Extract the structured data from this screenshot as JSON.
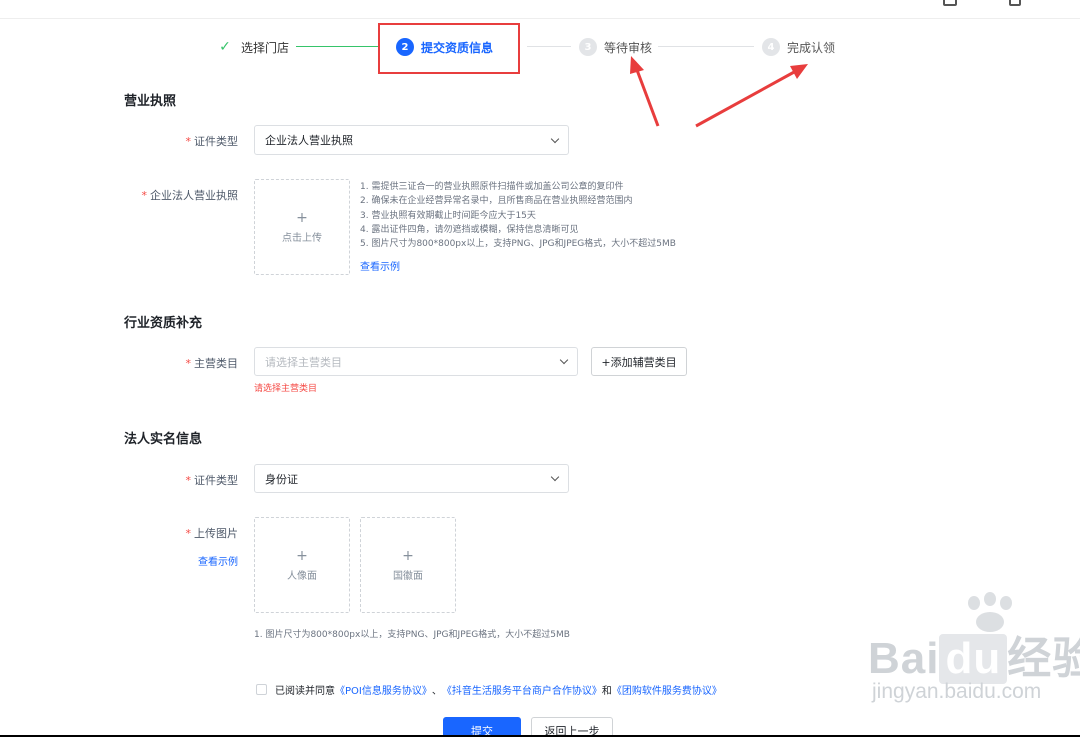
{
  "steps": [
    {
      "index": "✓",
      "label": "选择门店",
      "state": "done"
    },
    {
      "index": "2",
      "label": "提交资质信息",
      "state": "active"
    },
    {
      "index": "3",
      "label": "等待审核",
      "state": "wait"
    },
    {
      "index": "4",
      "label": "完成认领",
      "state": "wait"
    }
  ],
  "colors": {
    "primary": "#1966ff",
    "done": "#36c46a",
    "required": "#f54a45",
    "annotation": "#e83d3d"
  },
  "business_license": {
    "title": "营业执照",
    "cert_type_label": "证件类型",
    "cert_type_value": "企业法人营业执照",
    "license_label": "企业法人营业执照",
    "upload_text": "点击上传",
    "tips": [
      "1. 需提供三证合一的营业执照原件扫描件或加盖公司公章的复印件",
      "2. 确保未在企业经营异常名录中，且所售商品在营业执照经营范围内",
      "3. 营业执照有效期截止时间距今应大于15天",
      "4. 露出证件四角，请勿遮挡或模糊，保持信息清晰可见",
      "5. 图片尺寸为800*800px以上，支持PNG、JPG和JPEG格式，大小不超过5MB"
    ],
    "example_link": "查看示例"
  },
  "industry": {
    "title": "行业资质补充",
    "category_label": "主营类目",
    "category_placeholder": "请选择主营类目",
    "add_button": "+添加辅营类目",
    "error": "请选择主营类目"
  },
  "legal_person": {
    "title": "法人实名信息",
    "cert_type_label": "证件类型",
    "cert_type_value": "身份证",
    "upload_label": "上传图片",
    "example_link": "查看示例",
    "front_text": "人像面",
    "back_text": "国徽面",
    "tip": "1. 图片尺寸为800*800px以上，支持PNG、JPG和JPEG格式，大小不超过5MB"
  },
  "agreement": {
    "prefix": "已阅读并同意",
    "link1": "《POI信息服务协议》",
    "sep": "、",
    "link2": "《抖音生活服务平台商户合作协议》",
    "and": "和",
    "link3": "《团购软件服务费协议》"
  },
  "buttons": {
    "submit": "提交",
    "back": "返回上一步"
  },
  "watermark": {
    "brand": "Baidu经验",
    "brand_latin": "Bai",
    "brand_du": "du",
    "brand_cn": "经验",
    "url": "jingyan.baidu.com"
  }
}
